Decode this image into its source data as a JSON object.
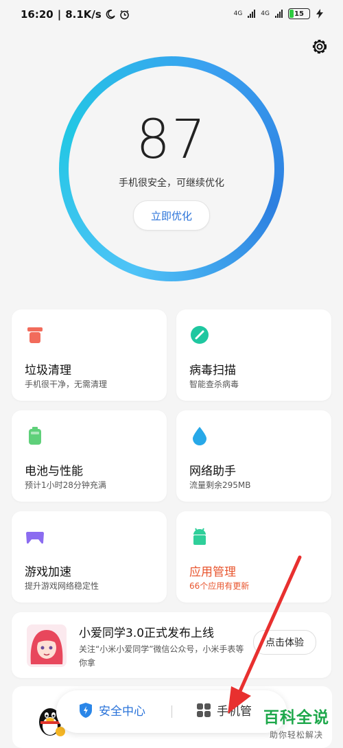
{
  "status_bar": {
    "time": "16:20",
    "speed": "8.1K/s",
    "net1": "4G",
    "net2": "4G",
    "battery": "15"
  },
  "score": {
    "value": "87",
    "message": "手机很安全，可继续优化",
    "button": "立即优化"
  },
  "cards": [
    {
      "title": "垃圾清理",
      "sub": "手机很干净，无需清理",
      "icon": "trash-icon",
      "color": "#f26b5b"
    },
    {
      "title": "病毒扫描",
      "sub": "智能查杀病毒",
      "icon": "virus-scan-icon",
      "color": "#1fc7a0"
    },
    {
      "title": "电池与性能",
      "sub": "预计1小时28分钟充满",
      "icon": "battery-icon",
      "color": "#5fd07a"
    },
    {
      "title": "网络助手",
      "sub": "流量剩余295MB",
      "icon": "water-drop-icon",
      "color": "#27a8e8"
    },
    {
      "title": "游戏加速",
      "sub": "提升游戏网络稳定性",
      "icon": "gamepad-icon",
      "color": "#8b6cf0"
    },
    {
      "title": "应用管理",
      "sub": "66个应用有更新",
      "icon": "android-icon",
      "color": "#2fcf9a",
      "highlight": "#e8552e"
    }
  ],
  "promo": {
    "title": "小爱同学3.0正式发布上线",
    "desc": "关注“小米小爱同学”微信公众号，小米手表等你拿",
    "button": "点击体验"
  },
  "bottom_nav": {
    "security": "安全中心",
    "manager": "手机管"
  },
  "watermark": {
    "main": "百科全说",
    "sub": "助你轻松解决"
  }
}
